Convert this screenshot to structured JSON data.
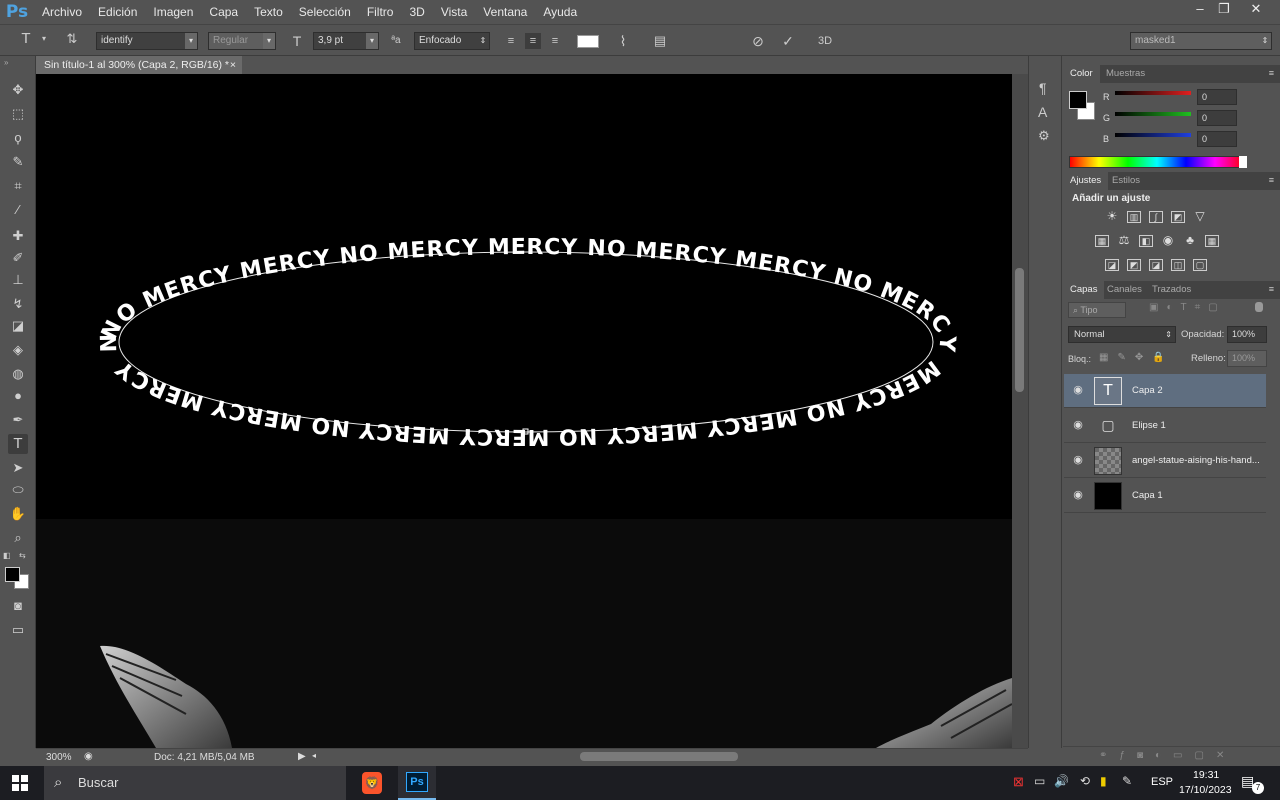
{
  "app": {
    "logo": "Ps"
  },
  "menu": [
    "Archivo",
    "Edición",
    "Imagen",
    "Capa",
    "Texto",
    "Selección",
    "Filtro",
    "3D",
    "Vista",
    "Ventana",
    "Ayuda"
  ],
  "window_controls": {
    "minimize": "–",
    "restore": "❐",
    "close": "✕"
  },
  "options": {
    "font_family": "identify",
    "font_style": "Regular",
    "font_size": "3,9 pt",
    "aa_label": "ªa",
    "antialias": "Enfocado",
    "threed": "3D",
    "workspace": "masked1"
  },
  "document": {
    "tab_title": "Sin título-1 al 300% (Capa 2, RGB/16) *",
    "tab_close": "×",
    "zoom": "300%",
    "doc_size": "Doc: 4,21 MB/5,04 MB",
    "path_text": "NO MERCY MERCY NO MERCY MERCY NO MERCY MERCY NO MERCY MERCY NO MERCY MERCY NO MERCY MERCY NO MERCY MERCY NO MERCY MERCY NO MERCY MERCY NO MERCY MERCY NO MERCY MERCY NO MERCY MERCY NO MERCY MERCY NO MERCY MERCY NO MERCY"
  },
  "color_panel": {
    "tabs": [
      "Color",
      "Muestras"
    ],
    "sliders": [
      {
        "label": "R",
        "value": "0",
        "color": "#e02020"
      },
      {
        "label": "G",
        "value": "0",
        "color": "#20c020"
      },
      {
        "label": "B",
        "value": "0",
        "color": "#2040e0"
      }
    ]
  },
  "adjust_panel": {
    "tabs": [
      "Ajustes",
      "Estilos"
    ],
    "heading": "Añadir un ajuste"
  },
  "layers_panel": {
    "tabs": [
      "Capas",
      "Canales",
      "Trazados"
    ],
    "filter_kind": "Tipo",
    "blend_mode": "Normal",
    "opacity_label": "Opacidad:",
    "opacity": "100%",
    "lock_label": "Bloq.:",
    "fill_label": "Relleno:",
    "fill": "100%",
    "layers": [
      {
        "name": "Capa 2",
        "kind": "text",
        "selected": true,
        "thumb_glyph": "T"
      },
      {
        "name": "Elipse 1",
        "kind": "shape",
        "selected": false,
        "thumb_glyph": "▢"
      },
      {
        "name": "angel-statue-aising-his-hand...",
        "kind": "image",
        "selected": false,
        "thumb_glyph": ""
      },
      {
        "name": "Capa 1",
        "kind": "fill",
        "selected": false,
        "thumb_glyph": ""
      }
    ],
    "footer_icons": [
      "link-icon",
      "fx-icon",
      "mask-icon",
      "adjustment-icon",
      "group-icon",
      "new-layer-icon",
      "trash-icon"
    ]
  },
  "taskbar": {
    "search_placeholder": "Buscar",
    "lang": "ESP",
    "time": "19:31",
    "date": "17/10/2023",
    "notifications": "7",
    "ps_label": "Ps"
  },
  "colors": {
    "ui_bg": "#535353",
    "canvas": "#000000",
    "selection": "#5f6e80",
    "ps_blue": "#31a8ff"
  }
}
